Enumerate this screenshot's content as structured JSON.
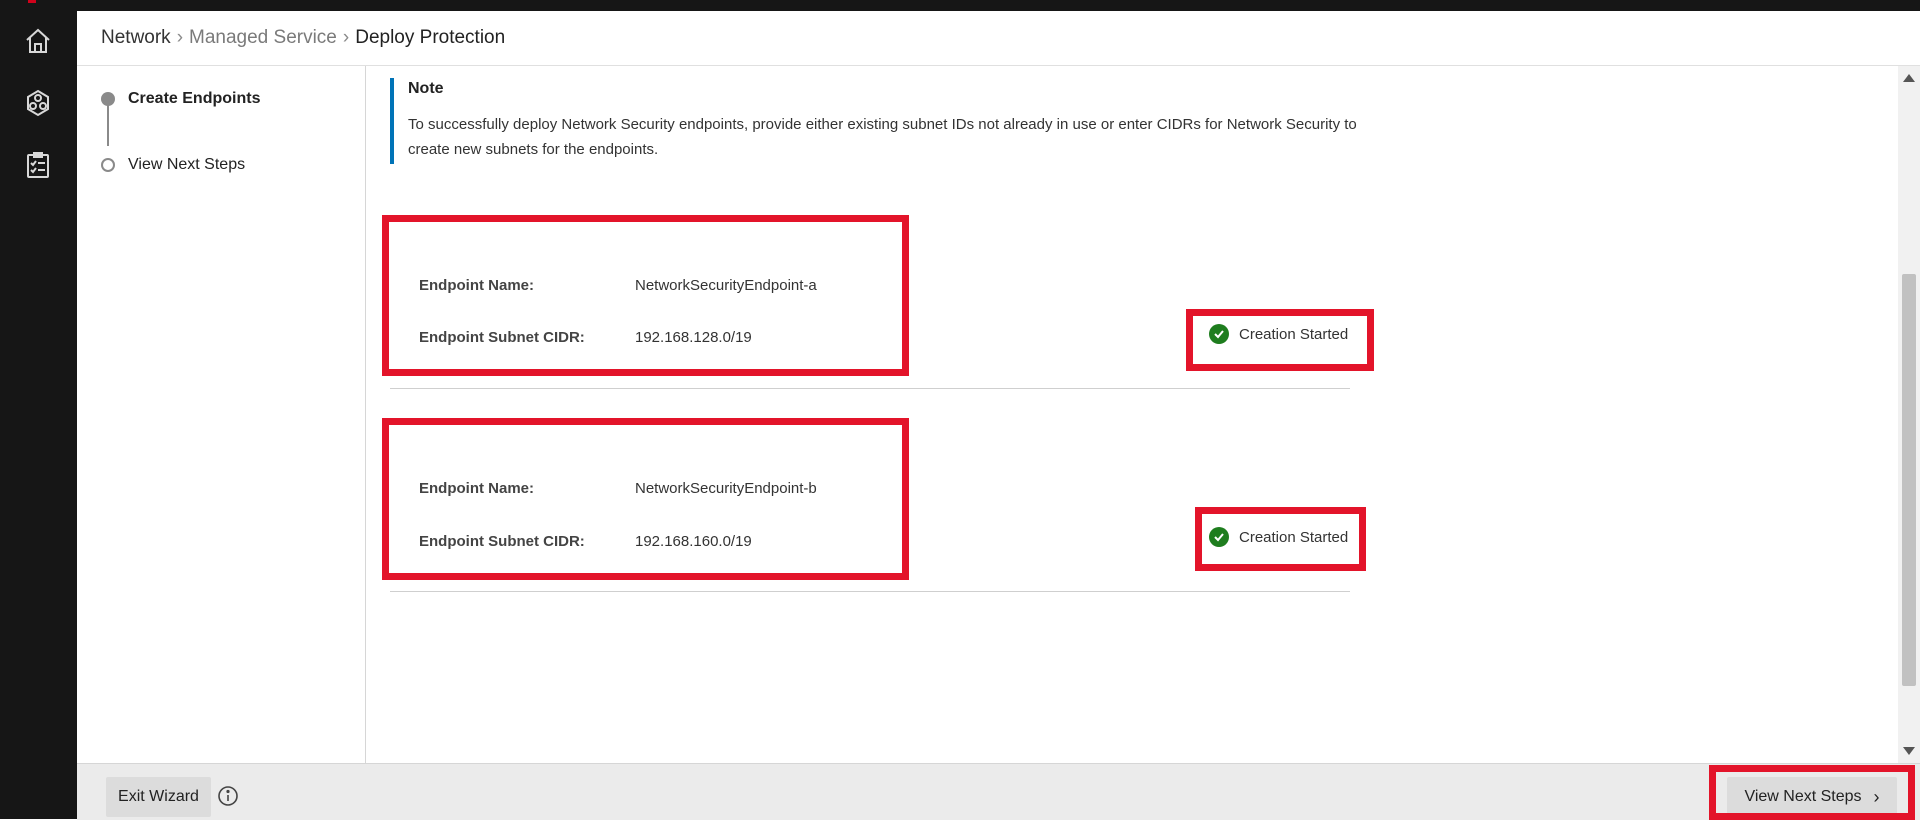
{
  "sidebar": {
    "icons": [
      "home-icon",
      "cluster-icon",
      "checklist-icon"
    ]
  },
  "breadcrumb": {
    "items": [
      "Network",
      "Managed Service",
      "Deploy Protection"
    ],
    "separator": "›"
  },
  "wizard_steps": [
    {
      "label": "Create Endpoints",
      "state": "active"
    },
    {
      "label": "View Next Steps",
      "state": "pending"
    }
  ],
  "note": {
    "title": "Note",
    "text": "To successfully deploy Network Security endpoints, provide either existing subnet IDs not already in use or enter CIDRs for Network Security to create new subnets for the endpoints."
  },
  "endpoints": [
    {
      "name_label": "Endpoint Name:",
      "name_value": "NetworkSecurityEndpoint-a",
      "cidr_label": "Endpoint Subnet CIDR:",
      "cidr_value": "192.168.128.0/19",
      "status": "Creation Started"
    },
    {
      "name_label": "Endpoint Name:",
      "name_value": "NetworkSecurityEndpoint-b",
      "cidr_label": "Endpoint Subnet CIDR:",
      "cidr_value": "192.168.160.0/19",
      "status": "Creation Started"
    }
  ],
  "footer": {
    "exit_label": "Exit Wizard",
    "next_label": "View Next Steps",
    "next_chevron": "›"
  },
  "colors": {
    "accent": "#0073b7",
    "highlight": "#e3142a",
    "success": "#1e7d1e",
    "sidebar": "#161616"
  }
}
